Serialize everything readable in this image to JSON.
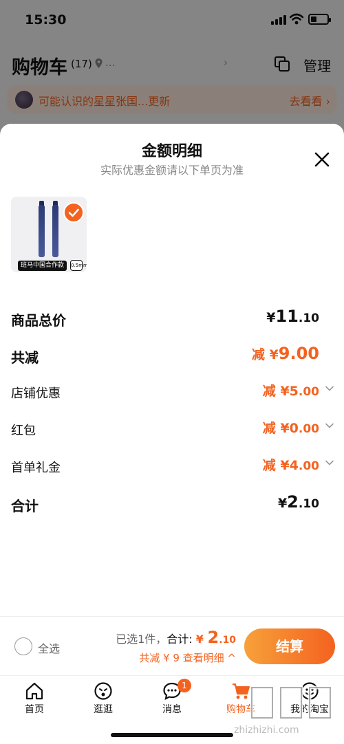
{
  "status_bar": {
    "time": "15:30"
  },
  "header": {
    "title": "购物车",
    "count": "(17)",
    "location_placeholder": "...",
    "location_arrow": "›",
    "manage_label": "管理"
  },
  "friend_banner": {
    "text": "可能认识的星星张国...更新",
    "link": "去看看 ›"
  },
  "sheet": {
    "title": "金额明细",
    "subtitle": "实际优惠金额请以下单页为准",
    "product": {
      "badge_text": "班马中国合作款",
      "size_text": "0.5mm"
    },
    "rows": [
      {
        "label": "商品总价",
        "prefix": "",
        "currency": "¥",
        "integer": "11",
        "decimal": ".10"
      },
      {
        "label": "共减",
        "prefix": "减 ",
        "currency": "¥",
        "integer": "9",
        "decimal": ".00"
      },
      {
        "label": "店铺优惠",
        "prefix": "减 ",
        "currency": "¥",
        "integer": "5",
        "decimal": ".00"
      },
      {
        "label": "红包",
        "prefix": "减 ",
        "currency": "¥",
        "integer": "0",
        "decimal": ".00"
      },
      {
        "label": "首单礼金",
        "prefix": "减 ",
        "currency": "¥",
        "integer": "4",
        "decimal": ".00"
      },
      {
        "label": "合计",
        "prefix": "",
        "currency": "¥",
        "integer": "2",
        "decimal": ".10"
      }
    ]
  },
  "checkout": {
    "select_all_label": "全选",
    "selected_text": "已选1件，",
    "total_label": "合计:",
    "currency": "¥",
    "total_integer": "2",
    "total_decimal": ".10",
    "detail_text": "共减 ¥ 9  查看明细 ^",
    "button_label": "结算"
  },
  "tabbar": {
    "tabs": [
      {
        "label": "首页",
        "icon": "home-icon"
      },
      {
        "label": "逛逛",
        "icon": "browse-icon"
      },
      {
        "label": "消息",
        "icon": "message-icon",
        "badge": "1"
      },
      {
        "label": "购物车",
        "icon": "cart-icon",
        "active": true
      },
      {
        "label": "我的淘宝",
        "icon": "profile-icon"
      }
    ]
  },
  "watermark": {
    "text": "zhizhizhi.com"
  },
  "colors": {
    "accent": "#f4621f",
    "accent_light": "#f7a13a"
  }
}
